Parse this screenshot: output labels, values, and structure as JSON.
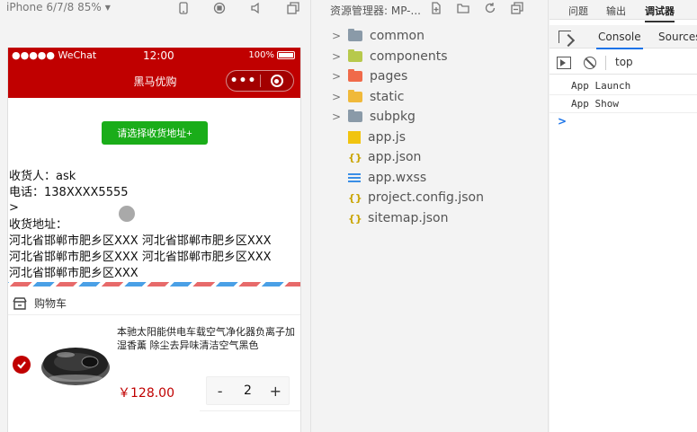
{
  "simulator": {
    "device_label": "iPhone 6/7/8 85%",
    "status": {
      "carrier": "●●●●● WeChat",
      "time": "12:00",
      "battery": "100%"
    },
    "nav_title": "黑马优购",
    "capsule_dots": "•••",
    "address_button": "请选择收货地址+",
    "receiver": "收货人：ask",
    "phone": "电话：138XXXX5555",
    "chevron": ">",
    "address_label": "收货地址：",
    "address_lines": [
      "河北省邯郸市肥乡区XXX 河北省邯郸市肥乡区XXX",
      "河北省邯郸市肥乡区XXX 河北省邯郸市肥乡区XXX",
      "河北省邯郸市肥乡区XXX"
    ],
    "cart_title": "购物车",
    "goods": {
      "title": "本驰太阳能供电车载空气净化器负离子加湿香薰 除尘去异味清洁空气黑色",
      "price": "￥128.00",
      "minus": "-",
      "quantity": "2",
      "plus": "+"
    },
    "accent": "#c00000"
  },
  "explorer": {
    "title": "资源管理器: MP-...",
    "items": [
      {
        "label": "common",
        "kind": "folder",
        "color": "#8a9aa8"
      },
      {
        "label": "components",
        "kind": "folder",
        "color": "#b7c94c"
      },
      {
        "label": "pages",
        "kind": "folder",
        "color": "#f06a4a"
      },
      {
        "label": "static",
        "kind": "folder",
        "color": "#f0b93a"
      },
      {
        "label": "subpkg",
        "kind": "folder",
        "color": "#8a9aa8"
      },
      {
        "label": "app.js",
        "kind": "js"
      },
      {
        "label": "app.json",
        "kind": "json"
      },
      {
        "label": "app.wxss",
        "kind": "wxss"
      },
      {
        "label": "project.config.json",
        "kind": "json"
      },
      {
        "label": "sitemap.json",
        "kind": "json"
      }
    ]
  },
  "devtools": {
    "tabs": [
      "问题",
      "输出",
      "调试器"
    ],
    "active_tab": "调试器",
    "sub_tabs": [
      "Console",
      "Sources"
    ],
    "active_sub_tab": "Console",
    "context": "top",
    "logs": [
      "App  Launch",
      "App  Show"
    ],
    "prompt": ">"
  }
}
